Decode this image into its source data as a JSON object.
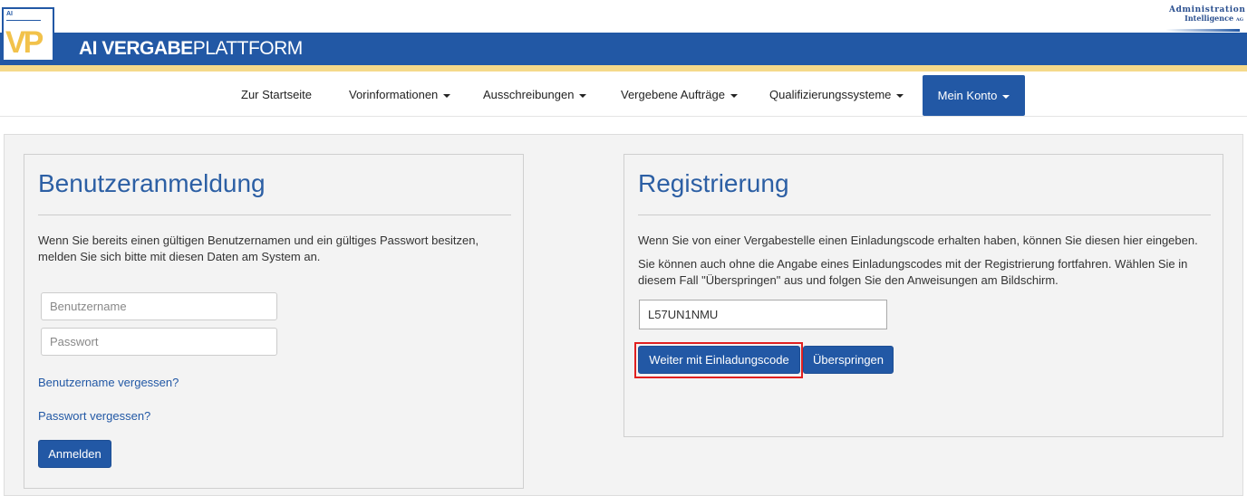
{
  "header": {
    "logo_small_text": "AI",
    "logo_letters": "VP",
    "brand_bold": "AI VERGABE",
    "brand_light": "PLATTFORM",
    "partner_line1": "Administration",
    "partner_line2": "Intelligence",
    "partner_suffix": "AG"
  },
  "nav": {
    "items": [
      {
        "label": "Zur Startseite"
      },
      {
        "label": "Vorinformationen"
      },
      {
        "label": "Ausschreibungen"
      },
      {
        "label": "Vergebene Aufträge"
      },
      {
        "label": "Qualifizierungssysteme"
      }
    ],
    "active_label": "Mein Konto"
  },
  "login": {
    "title": "Benutzeranmeldung",
    "text_line1": "Wenn Sie bereits einen gültigen Benutzernamen und ein gültiges Passwort besitzen,",
    "text_line2": "melden Sie sich bitte mit diesen Daten am System an.",
    "username_placeholder": "Benutzername",
    "password_placeholder": "Passwort",
    "forgot_username": "Benutzername vergessen?",
    "forgot_password": "Passwort vergessen?",
    "submit_label": "Anmelden"
  },
  "register": {
    "title": "Registrierung",
    "text1": "Wenn Sie von einer Vergabestelle einen Einladungscode erhalten haben, können Sie diesen hier eingeben.",
    "text2_line1": "Sie können auch ohne die Angabe eines Einladungscodes mit der Registrierung fortfahren. Wählen Sie in",
    "text2_line2": "diesem Fall \"Überspringen\" aus und folgen Sie den Anweisungen am Bildschirm.",
    "code_value": "L57UN1NMU",
    "continue_label": "Weiter mit Einladungscode",
    "skip_label": "Überspringen"
  },
  "colors": {
    "brand_blue": "#2258a5",
    "accent_yellow": "#f5d98a",
    "highlight_red": "#e02020"
  }
}
